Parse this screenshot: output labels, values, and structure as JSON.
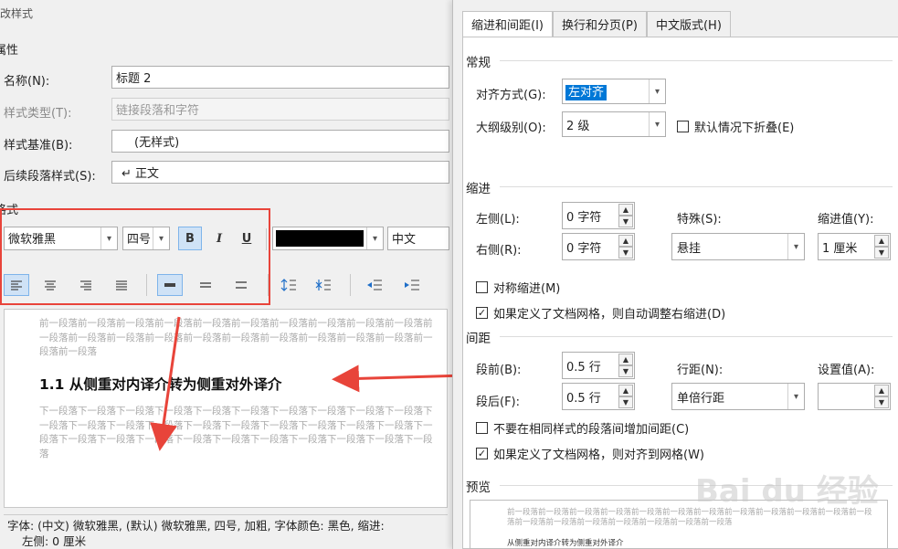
{
  "left_dialog": {
    "title": "修改样式",
    "properties_header": "属性",
    "name_label": "名称(N):",
    "name_value": "标题 2",
    "style_type_label": "样式类型(T):",
    "style_type_value": "链接段落和字符",
    "based_on_label": "样式基准(B):",
    "based_on_value": "(无样式)",
    "next_style_label": "后续段落样式(S):",
    "next_style_value": "↵ 正文",
    "format_header": "格式",
    "font_name": "微软雅黑",
    "font_size": "四号",
    "bold": "B",
    "italic": "I",
    "underline": "U",
    "script": "中文",
    "color": "#000000",
    "preview_before": "前一段落前一段落前一段落前一段落前一段落前一段落前一段落前一段落前一段落前一段落前一段落前一段落前一段落前一段落前一段落前一段落前一段落前一段落前一段落前一段落前一段落前一段落",
    "preview_heading": "1.1  从侧重对内译介转为侧重对外译介",
    "preview_after": "下一段落下一段落下一段落下一段落下一段落下一段落下一段落下一段落下一段落下一段落下一段落下一段落下一段落下一段落下一段落下一段落下一段落下一段落下一段落下一段落下一段落下一段落下一段落下一段落下一段落下一段落下一段落下一段落下一段落下一段落下一段落",
    "description_line1": "字体: (中文) 微软雅黑, (默认) 微软雅黑, 四号, 加粗, 字体颜色: 黑色, 缩进:",
    "description_line2": "左侧:  0 厘米"
  },
  "right_dialog": {
    "tabs": [
      "缩进和间距(I)",
      "换行和分页(P)",
      "中文版式(H)"
    ],
    "general_header": "常规",
    "alignment_label": "对齐方式(G):",
    "alignment_value": "左对齐",
    "outline_label": "大纲级别(O):",
    "outline_value": "2 级",
    "collapse_label": "默认情况下折叠(E)",
    "indent_header": "缩进",
    "left_label": "左侧(L):",
    "left_value": "0 字符",
    "right_label": "右侧(R):",
    "right_value": "0 字符",
    "special_label": "特殊(S):",
    "special_value": "悬挂",
    "indent_by_label": "缩进值(Y):",
    "indent_by_value": "1 厘米",
    "mirror_label": "对称缩进(M)",
    "auto_adjust_label": "如果定义了文档网格，则自动调整右缩进(D)",
    "spacing_header": "间距",
    "before_label": "段前(B):",
    "before_value": "0.5 行",
    "after_label": "段后(F):",
    "after_value": "0.5 行",
    "line_spacing_label": "行距(N):",
    "line_spacing_value": "单倍行距",
    "at_label": "设置值(A):",
    "at_value": "",
    "no_space_label": "不要在相同样式的段落间增加间距(C)",
    "snap_grid_label": "如果定义了文档网格，则对齐到网格(W)",
    "preview_header": "预览",
    "preview_text": "前一段落前一段落前一段落前一段落前一段落前一段落前一段落前一段落前一段落前一段落前一段落前一段落前一段落前一段落前一段落前一段落前一段落前一段落前一段落",
    "preview_heading": "从侧重对内译介转为侧重对外译介"
  },
  "watermark": "Bai du 经验",
  "colors": {
    "annotation_red": "#e8443a",
    "selection_blue": "#0078d7"
  }
}
